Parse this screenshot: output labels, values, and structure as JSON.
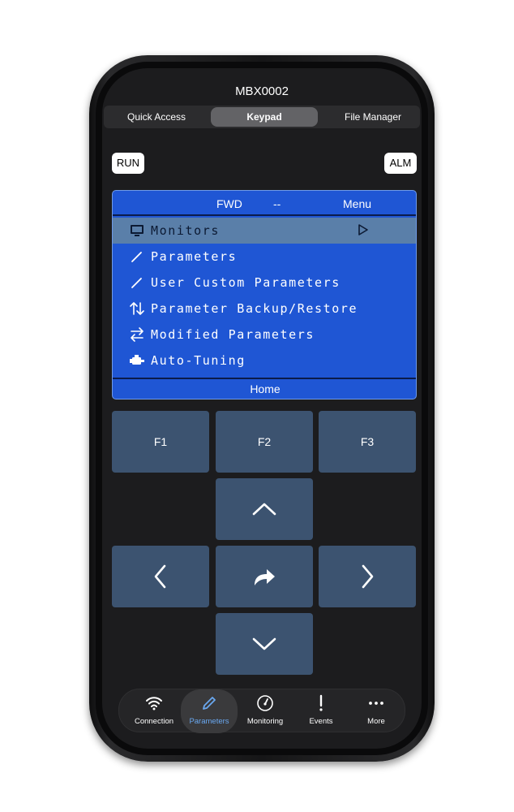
{
  "device": {
    "name": "MBX0002"
  },
  "tabs": [
    {
      "label": "Quick Access"
    },
    {
      "label": "Keypad"
    },
    {
      "label": "File Manager"
    }
  ],
  "indicators": {
    "run": "RUN",
    "alarm": "ALM"
  },
  "lcd": {
    "status": {
      "direction": "FWD",
      "ref": "--",
      "mode": "Menu"
    },
    "menu_items": [
      {
        "label": "Monitors",
        "icon": "monitor-icon",
        "selected": true
      },
      {
        "label": "Parameters",
        "icon": "pencil-icon"
      },
      {
        "label": "User Custom Parameters",
        "icon": "pencil-icon"
      },
      {
        "label": "Parameter Backup/Restore",
        "icon": "up-down-arrows-icon"
      },
      {
        "label": "Modified Parameters",
        "icon": "left-right-arrows-icon"
      },
      {
        "label": "Auto-Tuning",
        "icon": "motor-icon"
      }
    ],
    "footer": "Home",
    "colors": {
      "background": "#1f56d4",
      "selected_row": "#5a7fa9"
    }
  },
  "keypad": {
    "function_keys": [
      {
        "label": "F1"
      },
      {
        "label": "F2"
      },
      {
        "label": "F3"
      }
    ],
    "nav_keys": [
      "up-arrow-icon",
      "left-arrow-icon",
      "enter-icon",
      "right-arrow-icon",
      "down-arrow-icon"
    ],
    "color": "#3c5370"
  },
  "bottom_nav": [
    {
      "label": "Connection",
      "icon": "wifi-icon"
    },
    {
      "label": "Parameters",
      "icon": "pencil-icon",
      "active": true
    },
    {
      "label": "Monitoring",
      "icon": "gauge-icon"
    },
    {
      "label": "Events",
      "icon": "exclamation-icon"
    },
    {
      "label": "More",
      "icon": "ellipsis-icon"
    }
  ],
  "accent_color": "#6aa8f0"
}
